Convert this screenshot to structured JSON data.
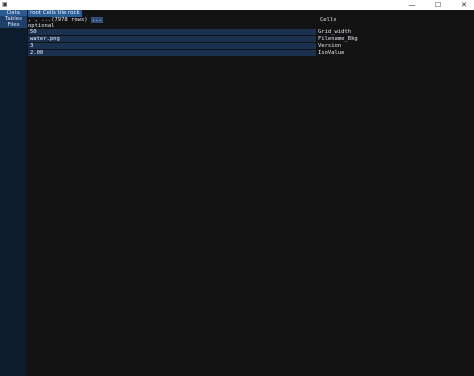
{
  "window": {
    "icon": "app-icon",
    "minimize": "—",
    "maximize": "☐",
    "close": "✕"
  },
  "sidebar": {
    "items": [
      {
        "label": "Data"
      },
      {
        "label": "Tables"
      },
      {
        "label": "Files"
      }
    ]
  },
  "breadcrumb": {
    "text": "root Cells tile rock"
  },
  "nav": {
    "arrows": ", , ...",
    "rows": "(7978 rows)",
    "more": "..."
  },
  "panel": {
    "section_label": "optional",
    "title": "Cells"
  },
  "fields": [
    {
      "value": "50",
      "label": "Grid_width"
    },
    {
      "value": "water.png",
      "label": "Filename_Bkg"
    },
    {
      "value": "3",
      "label": "Version"
    },
    {
      "value": "2.00",
      "label": "IsoValue"
    }
  ],
  "colors": {
    "background": "#131313",
    "sidebar": "#0d1b2c",
    "accent": "#2a5d95",
    "input": "#1b3150"
  }
}
